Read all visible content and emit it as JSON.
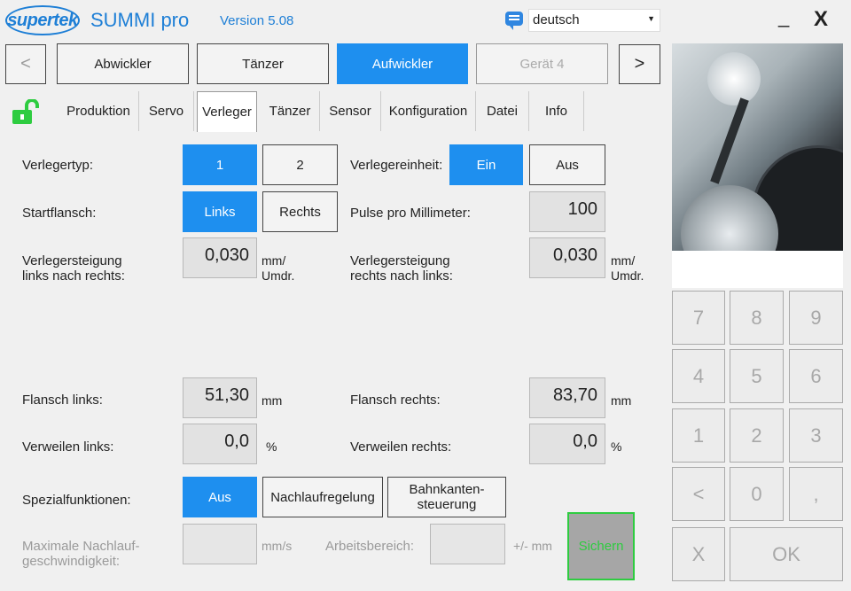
{
  "header": {
    "logo_text": "supertek",
    "app_title": "SUMMI pro",
    "version": "Version 5.08",
    "language": "deutsch",
    "minimize": "_",
    "close": "X"
  },
  "device_nav": {
    "prev": "<",
    "next": ">",
    "devices": [
      "Abwickler",
      "Tänzer",
      "Aufwickler",
      "Gerät 4"
    ],
    "active": "Aufwickler"
  },
  "tabs": {
    "items": [
      "Produktion",
      "Servo",
      "Verleger",
      "Tänzer",
      "Sensor",
      "Konfiguration",
      "Datei",
      "Info"
    ],
    "active": "Verleger"
  },
  "form": {
    "verlegertyp": {
      "label": "Verlegertyp:",
      "options": [
        "1",
        "2"
      ],
      "selected": "1"
    },
    "verlegereinheit": {
      "label": "Verlegereinheit:",
      "options": [
        "Ein",
        "Aus"
      ],
      "selected": "Ein"
    },
    "startflansch": {
      "label": "Startflansch:",
      "options": [
        "Links",
        "Rechts"
      ],
      "selected": "Links"
    },
    "pulse": {
      "label": "Pulse pro Millimeter:",
      "value": "100"
    },
    "steigung_lr": {
      "label_line1": "Verlegersteigung",
      "label_line2": "links nach rechts:",
      "value": "0,030",
      "unit_line1": "mm/",
      "unit_line2": "Umdr."
    },
    "steigung_rl": {
      "label_line1": "Verlegersteigung",
      "label_line2": "rechts nach links:",
      "value": "0,030",
      "unit_line1": "mm/",
      "unit_line2": "Umdr."
    },
    "flansch_links": {
      "label": "Flansch links:",
      "value": "51,30",
      "unit": "mm"
    },
    "flansch_rechts": {
      "label": "Flansch rechts:",
      "value": "83,70",
      "unit": "mm"
    },
    "verweilen_links": {
      "label": "Verweilen links:",
      "value": "0,0",
      "unit": "%"
    },
    "verweilen_rechts": {
      "label": "Verweilen rechts:",
      "value": "0,0",
      "unit": "%"
    },
    "spezial": {
      "label": "Spezialfunktionen:",
      "options": [
        "Aus",
        "Nachlaufregelung"
      ],
      "option3_line1": "Bahnkanten-",
      "option3_line2": "steuerung",
      "selected": "Aus"
    },
    "nachlauf": {
      "label_line1": "Maximale Nachlauf-",
      "label_line2": "geschwindigkeit:",
      "value": "",
      "unit": "mm/s"
    },
    "arbeitsbereich": {
      "label": "Arbeitsbereich:",
      "value": "",
      "unit": "+/- mm"
    },
    "save": "Sichern"
  },
  "keypad": {
    "keys": [
      "7",
      "8",
      "9",
      "4",
      "5",
      "6",
      "1",
      "2",
      "3",
      "<",
      "0",
      ","
    ],
    "cancel": "X",
    "ok": "OK"
  },
  "colors": {
    "accent": "#1e8fef",
    "brand": "#1e7fd6",
    "save_border": "#2ecc40",
    "lock": "#2ecc40"
  }
}
